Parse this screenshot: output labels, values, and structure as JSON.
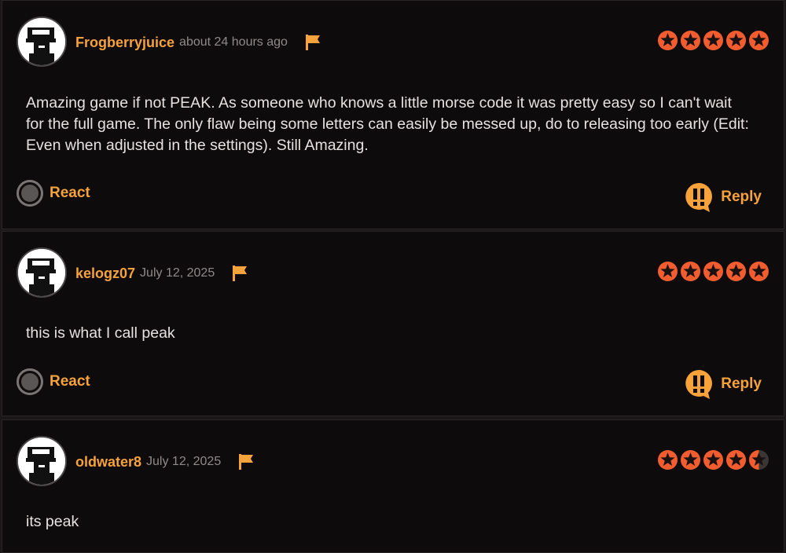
{
  "comments": [
    {
      "username": "Frogberryjuice",
      "timestamp": "about 24 hours ago",
      "rating": 5,
      "text": "Amazing game if not PEAK. As someone who knows a little morse code it was pretty easy so I can't wait for the full game. The only flaw being some letters can easily be messed up, do to releasing too early (Edit: Even when adjusted in the settings). Still Amazing.",
      "react_label": "React",
      "reply_label": "Reply"
    },
    {
      "username": "kelogz07",
      "timestamp": "July 12, 2025",
      "rating": 5,
      "text": "this is what I call peak",
      "react_label": "React",
      "reply_label": "Reply"
    },
    {
      "username": "oldwater8",
      "timestamp": "July 12, 2025",
      "rating": 4.5,
      "text": "its peak"
    }
  ],
  "icons": {
    "avatar": "pixel-avatar-icon",
    "flag": "flag-icon",
    "star": "star-icon",
    "react": "react-circle-icon",
    "reply": "reply-bubble-icon"
  },
  "colors": {
    "accent": "#f7a23b",
    "star_fill": "#f25c2e",
    "star_empty": "#3a3636"
  }
}
